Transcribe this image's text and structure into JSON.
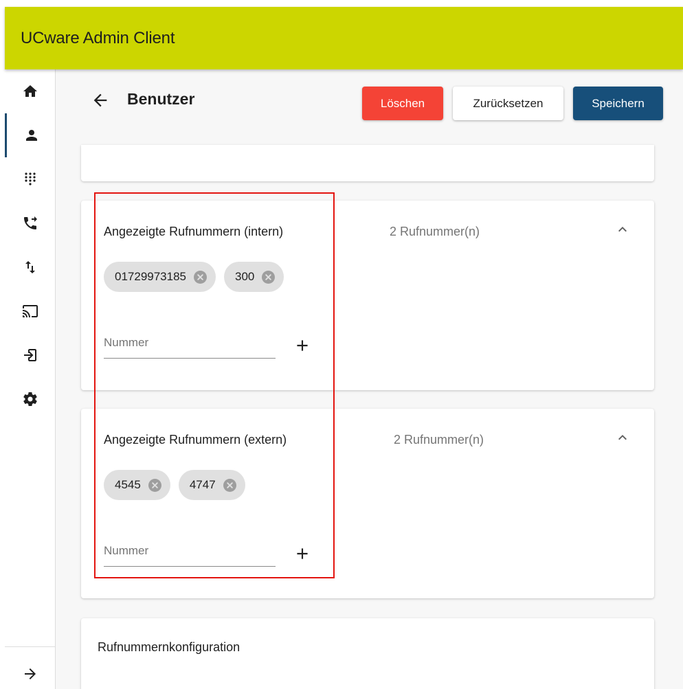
{
  "app": {
    "title": "UCware Admin Client"
  },
  "page": {
    "title": "Benutzer"
  },
  "actions": {
    "delete": "Löschen",
    "reset": "Zurücksetzen",
    "save": "Speichern"
  },
  "colors": {
    "app_bar": "#ccd600",
    "delete": "#f44336",
    "save": "#174f7a",
    "highlight": "#e3140f"
  },
  "sidebar": {
    "items": [
      {
        "icon": "home-icon"
      },
      {
        "icon": "person-icon",
        "active": true
      },
      {
        "icon": "dialpad-icon"
      },
      {
        "icon": "call-forward-icon"
      },
      {
        "icon": "swap-vert-icon"
      },
      {
        "icon": "cast-icon"
      },
      {
        "icon": "login-icon"
      },
      {
        "icon": "settings-icon"
      }
    ],
    "footer_icon": "arrow-forward-icon"
  },
  "sections": {
    "intern": {
      "title": "Angezeigte Rufnummern (intern)",
      "count": "2 Rufnummer(n)",
      "chips": [
        "01729973185",
        "300"
      ],
      "input_placeholder": "Nummer"
    },
    "extern": {
      "title": "Angezeigte Rufnummern (extern)",
      "count": "2 Rufnummer(n)",
      "chips": [
        "4545",
        "4747"
      ],
      "input_placeholder": "Nummer"
    },
    "config": {
      "title": "Rufnummernkonfiguration"
    }
  }
}
